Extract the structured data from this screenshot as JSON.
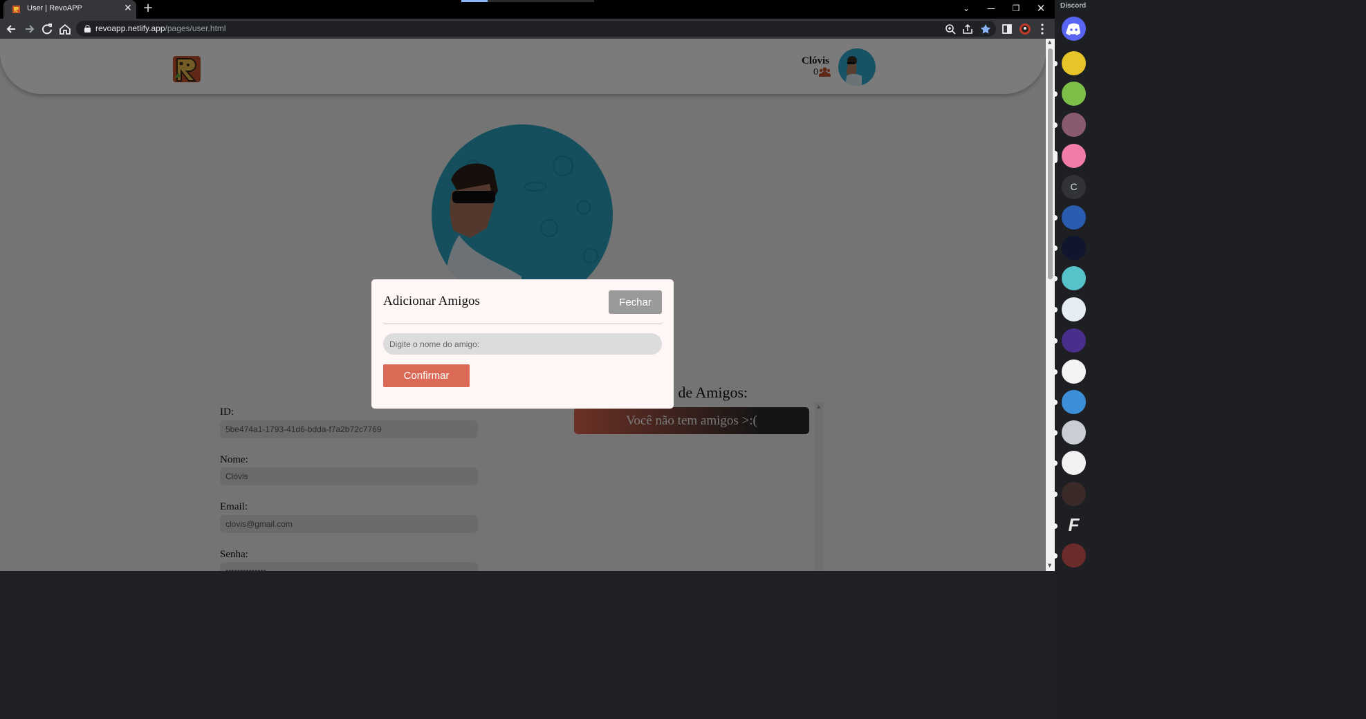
{
  "browser": {
    "tab_title": "User | RevoAPP",
    "url_host": "revoapp.netlify.app",
    "url_path": "/pages/user.html"
  },
  "header": {
    "user_name": "Clóvis",
    "friend_count": "0"
  },
  "profile": {
    "fields": [
      {
        "label": "ID:",
        "value": "5be474a1-1793-41d6-bdda-f7a2b72c7769"
      },
      {
        "label": "Nome:",
        "value": "Clóvis"
      },
      {
        "label": "Email:",
        "value": "clovis@gmail.com"
      },
      {
        "label": "Senha:",
        "value": "••••••••••••••"
      }
    ]
  },
  "friends": {
    "title": "Lista de Amigos:",
    "empty_message": "Você não tem amigos >:("
  },
  "modal": {
    "title": "Adicionar Amigos",
    "close_label": "Fechar",
    "input_placeholder": "Digite o nome do amigo:",
    "confirm_label": "Confirmar"
  },
  "discord": {
    "title": "Discord",
    "server_letter": "C"
  },
  "colors": {
    "accent": "#da6a55",
    "close_button": "#9a9a9a",
    "modal_bg": "#fff6f6"
  }
}
